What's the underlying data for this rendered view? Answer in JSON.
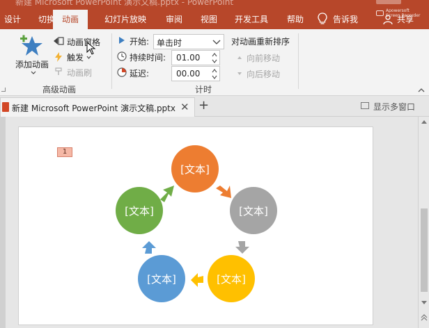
{
  "titlebar": {
    "ghost_title": "新建 Microsoft PowerPoint 演示文稿.pptx - PowerPoint",
    "tabs": [
      {
        "label": "设计",
        "active": false
      },
      {
        "label": "切换",
        "active": false
      },
      {
        "label": "动画",
        "active": true
      },
      {
        "label": "幻灯片放映",
        "active": false
      },
      {
        "label": "审阅",
        "active": false
      },
      {
        "label": "视图",
        "active": false
      },
      {
        "label": "开发工具",
        "active": false
      },
      {
        "label": "帮助",
        "active": false
      }
    ],
    "tell_me": "告诉我",
    "share": "共享",
    "watermark_line1": "Apowersoft",
    "watermark_line2": "Screen Recorder"
  },
  "ribbon": {
    "advanced": {
      "add_animation": "添加动画",
      "animation_pane": "动画窗格",
      "trigger": "触发",
      "animation_painter": "动画刷",
      "group_label": "高级动画"
    },
    "timing": {
      "start_label": "开始:",
      "start_value": "单击时",
      "duration_label": "持续时间:",
      "duration_value": "01.00",
      "delay_label": "延迟:",
      "delay_value": "00.00",
      "group_label": "计时"
    },
    "reorder": {
      "title": "对动画重新排序",
      "move_earlier": "向前移动",
      "move_later": "向后移动"
    }
  },
  "document": {
    "tab_name": "新建 Microsoft PowerPoint 演示文稿.pptx",
    "multi_window": "显示多窗口"
  },
  "slide": {
    "animation_badge": "1",
    "nodes": [
      {
        "label": "[文本]",
        "color": "#ed7d31"
      },
      {
        "label": "[文本]",
        "color": "#a5a5a5"
      },
      {
        "label": "[文本]",
        "color": "#ffc000"
      },
      {
        "label": "[文本]",
        "color": "#5b9bd5"
      },
      {
        "label": "[文本]",
        "color": "#70ad47"
      }
    ]
  },
  "colors": {
    "ribbon_accent": "#b7472a"
  }
}
